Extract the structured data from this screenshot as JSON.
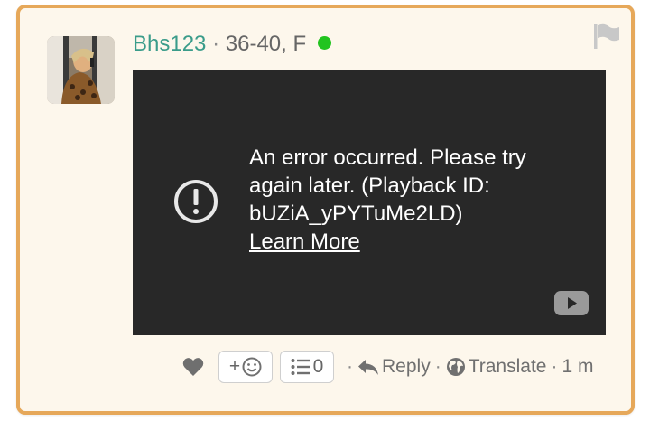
{
  "post": {
    "username": "Bhs123",
    "separator": "·",
    "age_gender": "36-40, F",
    "online": true
  },
  "video": {
    "error_message": "An error occurred. Please try again later. (Playback ID: bUZiA_yPYTuMe2LD)",
    "learn_more_label": "Learn More"
  },
  "footer": {
    "emoji_add_label": "+",
    "list_count": "0",
    "reply_label": "Reply",
    "translate_label": "Translate",
    "timestamp": "1 m",
    "sep": "·"
  },
  "colors": {
    "card_border": "#e6a85a",
    "card_background": "#fdf7ec",
    "username": "#3a9c8a",
    "online": "#22c41f",
    "player_background": "#282828"
  },
  "icons": [
    "avatar-photo",
    "flag-icon",
    "alert-circle-icon",
    "youtube-icon",
    "heart-icon",
    "smiley-icon",
    "list-icon",
    "reply-arrow-icon",
    "globe-icon"
  ]
}
